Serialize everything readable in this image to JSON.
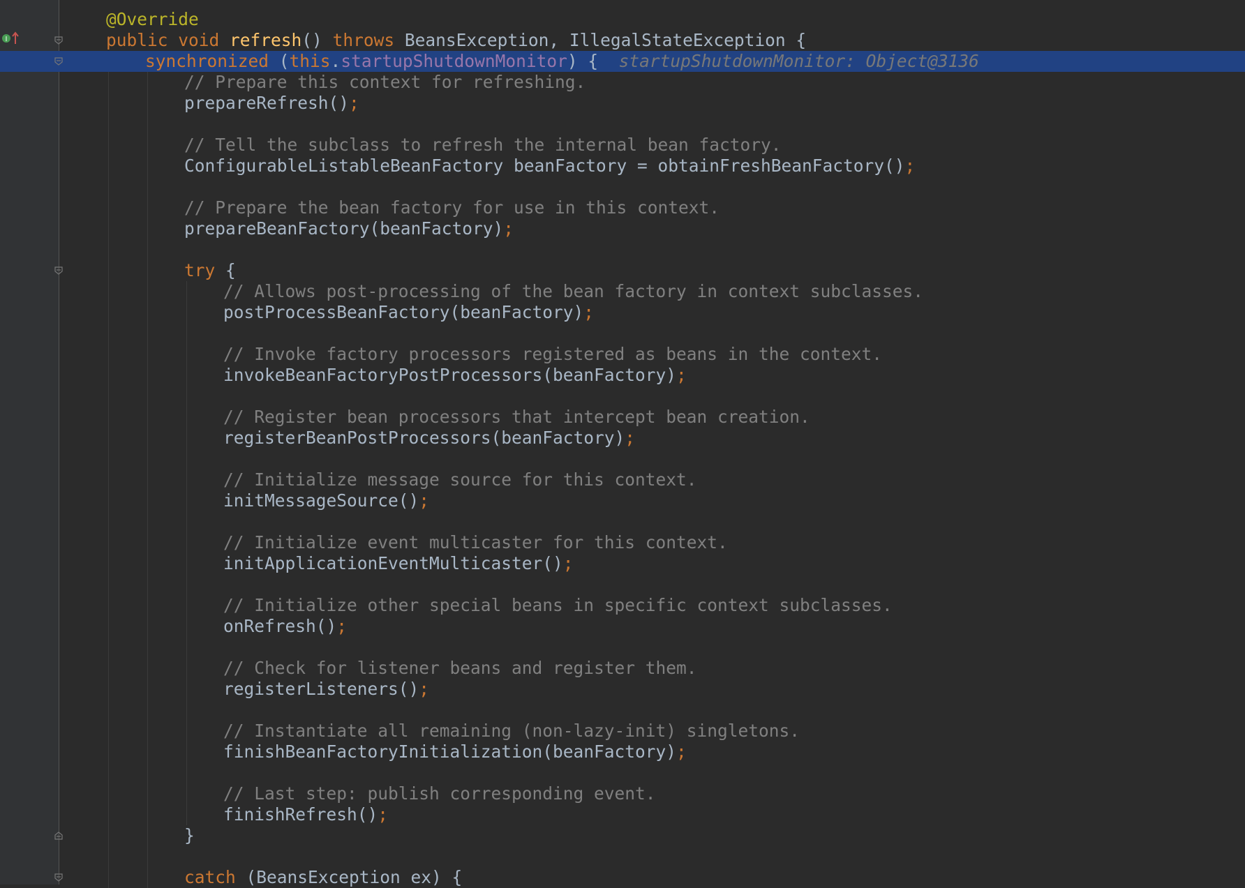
{
  "editor": {
    "debug_inlay": "startupShutdownMonitor: Object@3136",
    "lines": [
      {
        "id": "l0",
        "indent": 0,
        "tokens": [
          {
            "t": "@Override",
            "c": "ann"
          }
        ]
      },
      {
        "id": "l1",
        "indent": 0,
        "tokens": [
          {
            "t": "public ",
            "c": "kw"
          },
          {
            "t": "void ",
            "c": "kw"
          },
          {
            "t": "refresh",
            "c": "fn"
          },
          {
            "t": "() ",
            "c": "id"
          },
          {
            "t": "throws ",
            "c": "kw"
          },
          {
            "t": "BeansException, IllegalStateException {",
            "c": "id"
          }
        ]
      },
      {
        "id": "l2",
        "indent": 1,
        "tokens": [
          {
            "t": "synchronized ",
            "c": "kw"
          },
          {
            "t": "(",
            "c": "id"
          },
          {
            "t": "this",
            "c": "kw"
          },
          {
            "t": ".",
            "c": "id"
          },
          {
            "t": "startupShutdownMonitor",
            "c": "fld"
          },
          {
            "t": ") {",
            "c": "id"
          }
        ]
      },
      {
        "id": "l3",
        "indent": 2,
        "tokens": [
          {
            "t": "// Prepare this context for refreshing.",
            "c": "cm"
          }
        ]
      },
      {
        "id": "l4",
        "indent": 2,
        "tokens": [
          {
            "t": "prepareRefresh()",
            "c": "id"
          },
          {
            "t": ";",
            "c": "semi"
          }
        ]
      },
      {
        "id": "l5",
        "indent": 0,
        "tokens": []
      },
      {
        "id": "l6",
        "indent": 2,
        "tokens": [
          {
            "t": "// Tell the subclass to refresh the internal bean factory.",
            "c": "cm"
          }
        ]
      },
      {
        "id": "l7",
        "indent": 2,
        "tokens": [
          {
            "t": "ConfigurableListableBeanFactory beanFactory = obtainFreshBeanFactory()",
            "c": "id"
          },
          {
            "t": ";",
            "c": "semi"
          }
        ]
      },
      {
        "id": "l8",
        "indent": 0,
        "tokens": []
      },
      {
        "id": "l9",
        "indent": 2,
        "tokens": [
          {
            "t": "// Prepare the bean factory for use in this context.",
            "c": "cm"
          }
        ]
      },
      {
        "id": "l10",
        "indent": 2,
        "tokens": [
          {
            "t": "prepareBeanFactory(beanFactory)",
            "c": "id"
          },
          {
            "t": ";",
            "c": "semi"
          }
        ]
      },
      {
        "id": "l11",
        "indent": 0,
        "tokens": []
      },
      {
        "id": "l12",
        "indent": 2,
        "tokens": [
          {
            "t": "try ",
            "c": "kw"
          },
          {
            "t": "{",
            "c": "id"
          }
        ]
      },
      {
        "id": "l13",
        "indent": 3,
        "tokens": [
          {
            "t": "// Allows post-processing of the bean factory in context subclasses.",
            "c": "cm"
          }
        ]
      },
      {
        "id": "l14",
        "indent": 3,
        "tokens": [
          {
            "t": "postProcessBeanFactory(beanFactory)",
            "c": "id"
          },
          {
            "t": ";",
            "c": "semi"
          }
        ]
      },
      {
        "id": "l15",
        "indent": 0,
        "tokens": []
      },
      {
        "id": "l16",
        "indent": 3,
        "tokens": [
          {
            "t": "// Invoke factory processors registered as beans in the context.",
            "c": "cm"
          }
        ]
      },
      {
        "id": "l17",
        "indent": 3,
        "tokens": [
          {
            "t": "invokeBeanFactoryPostProcessors(beanFactory)",
            "c": "id"
          },
          {
            "t": ";",
            "c": "semi"
          }
        ]
      },
      {
        "id": "l18",
        "indent": 0,
        "tokens": []
      },
      {
        "id": "l19",
        "indent": 3,
        "tokens": [
          {
            "t": "// Register bean processors that intercept bean creation.",
            "c": "cm"
          }
        ]
      },
      {
        "id": "l20",
        "indent": 3,
        "tokens": [
          {
            "t": "registerBeanPostProcessors(beanFactory)",
            "c": "id"
          },
          {
            "t": ";",
            "c": "semi"
          }
        ]
      },
      {
        "id": "l21",
        "indent": 0,
        "tokens": []
      },
      {
        "id": "l22",
        "indent": 3,
        "tokens": [
          {
            "t": "// Initialize message source for this context.",
            "c": "cm"
          }
        ]
      },
      {
        "id": "l23",
        "indent": 3,
        "tokens": [
          {
            "t": "initMessageSource()",
            "c": "id"
          },
          {
            "t": ";",
            "c": "semi"
          }
        ]
      },
      {
        "id": "l24",
        "indent": 0,
        "tokens": []
      },
      {
        "id": "l25",
        "indent": 3,
        "tokens": [
          {
            "t": "// Initialize event multicaster for this context.",
            "c": "cm"
          }
        ]
      },
      {
        "id": "l26",
        "indent": 3,
        "tokens": [
          {
            "t": "initApplicationEventMulticaster()",
            "c": "id"
          },
          {
            "t": ";",
            "c": "semi"
          }
        ]
      },
      {
        "id": "l27",
        "indent": 0,
        "tokens": []
      },
      {
        "id": "l28",
        "indent": 3,
        "tokens": [
          {
            "t": "// Initialize other special beans in specific context subclasses.",
            "c": "cm"
          }
        ]
      },
      {
        "id": "l29",
        "indent": 3,
        "tokens": [
          {
            "t": "onRefresh()",
            "c": "id"
          },
          {
            "t": ";",
            "c": "semi"
          }
        ]
      },
      {
        "id": "l30",
        "indent": 0,
        "tokens": []
      },
      {
        "id": "l31",
        "indent": 3,
        "tokens": [
          {
            "t": "// Check for listener beans and register them.",
            "c": "cm"
          }
        ]
      },
      {
        "id": "l32",
        "indent": 3,
        "tokens": [
          {
            "t": "registerListeners()",
            "c": "id"
          },
          {
            "t": ";",
            "c": "semi"
          }
        ]
      },
      {
        "id": "l33",
        "indent": 0,
        "tokens": []
      },
      {
        "id": "l34",
        "indent": 3,
        "tokens": [
          {
            "t": "// Instantiate all remaining (non-lazy-init) singletons.",
            "c": "cm"
          }
        ]
      },
      {
        "id": "l35",
        "indent": 3,
        "tokens": [
          {
            "t": "finishBeanFactoryInitialization(beanFactory)",
            "c": "id"
          },
          {
            "t": ";",
            "c": "semi"
          }
        ]
      },
      {
        "id": "l36",
        "indent": 0,
        "tokens": []
      },
      {
        "id": "l37",
        "indent": 3,
        "tokens": [
          {
            "t": "// Last step: publish corresponding event.",
            "c": "cm"
          }
        ]
      },
      {
        "id": "l38",
        "indent": 3,
        "tokens": [
          {
            "t": "finishRefresh()",
            "c": "id"
          },
          {
            "t": ";",
            "c": "semi"
          }
        ]
      },
      {
        "id": "l39",
        "indent": 2,
        "tokens": [
          {
            "t": "}",
            "c": "id"
          }
        ]
      },
      {
        "id": "l40",
        "indent": 0,
        "tokens": []
      },
      {
        "id": "l41",
        "indent": 2,
        "tokens": [
          {
            "t": "catch ",
            "c": "kw"
          },
          {
            "t": "(BeansException ex) {",
            "c": "id"
          }
        ]
      }
    ]
  },
  "colors": {
    "background": "#2b2b2b",
    "gutter": "#313335",
    "execution_line": "#214283",
    "keyword": "#cc7832",
    "annotation": "#bbb529",
    "comment": "#808080",
    "method_decl": "#ffc66d",
    "field": "#9876aa",
    "identifier": "#a9b7c6"
  },
  "gutter_icons": [
    "implements-method-icon",
    "fold-marker-icon"
  ]
}
